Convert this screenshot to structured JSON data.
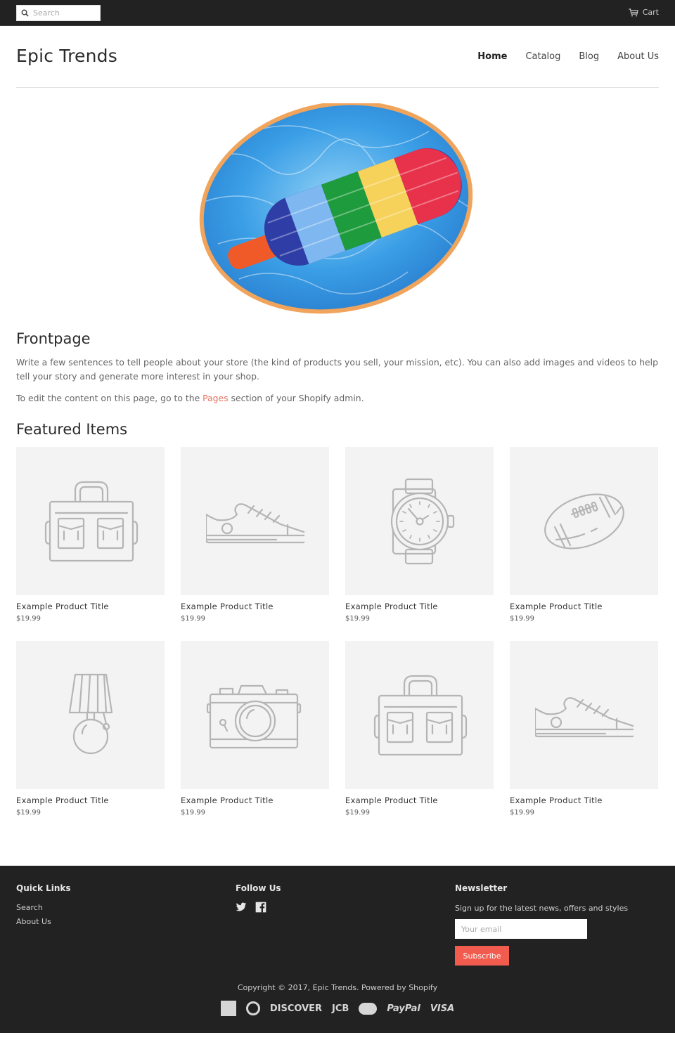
{
  "topbar": {
    "search_placeholder": "Search",
    "search_icon": "search-icon",
    "cart_label": "Cart",
    "cart_icon": "cart-icon"
  },
  "header": {
    "logo": "Epic Trends",
    "nav": [
      {
        "label": "Home",
        "active": true
      },
      {
        "label": "Catalog",
        "active": false
      },
      {
        "label": "Blog",
        "active": false
      },
      {
        "label": "About Us",
        "active": false
      }
    ]
  },
  "hero": {
    "image": "popsicle-pool-float-image"
  },
  "frontpage": {
    "title": "Frontpage",
    "paragraph1": "Write a few sentences to tell people about your store (the kind of products you sell, your mission, etc). You can also add images and videos to help tell your story and generate more interest in your shop.",
    "paragraph2_before": "To edit the content on this page, go to the ",
    "paragraph2_link": "Pages",
    "paragraph2_after": " section of your Shopify admin."
  },
  "featured": {
    "title": "Featured Items",
    "products": [
      {
        "title": "Example Product Title",
        "price": "$19.99",
        "icon": "bag-icon"
      },
      {
        "title": "Example Product Title",
        "price": "$19.99",
        "icon": "sneaker-icon"
      },
      {
        "title": "Example Product Title",
        "price": "$19.99",
        "icon": "watch-icon"
      },
      {
        "title": "Example Product Title",
        "price": "$19.99",
        "icon": "football-icon"
      },
      {
        "title": "Example Product Title",
        "price": "$19.99",
        "icon": "lamp-icon"
      },
      {
        "title": "Example Product Title",
        "price": "$19.99",
        "icon": "camera-icon"
      },
      {
        "title": "Example Product Title",
        "price": "$19.99",
        "icon": "bag-icon"
      },
      {
        "title": "Example Product Title",
        "price": "$19.99",
        "icon": "sneaker-icon"
      }
    ]
  },
  "footer": {
    "quick_links_title": "Quick Links",
    "quick_links": [
      "Search",
      "About Us"
    ],
    "follow_title": "Follow Us",
    "social": [
      "twitter-icon",
      "facebook-icon"
    ],
    "newsletter_title": "Newsletter",
    "newsletter_text": "Sign up for the latest news, offers and styles",
    "email_placeholder": "Your email",
    "subscribe_label": "Subscribe",
    "copyright": "Copyright © 2017, Epic Trends. Powered by Shopify",
    "payments": [
      "American Express",
      "Diners Club",
      "DISCOVER",
      "JCB",
      "MasterCard",
      "PayPal",
      "VISA"
    ],
    "payment_labels": {
      "discover": "DISCOVER",
      "jcb": "JCB",
      "paypal": "PayPal",
      "visa": "VISA"
    }
  },
  "colors": {
    "topbar_bg": "#222222",
    "footer_bg": "#222222",
    "accent": "#f15c4f",
    "link": "#e8735f",
    "thumb_bg": "#f3f3f3"
  }
}
